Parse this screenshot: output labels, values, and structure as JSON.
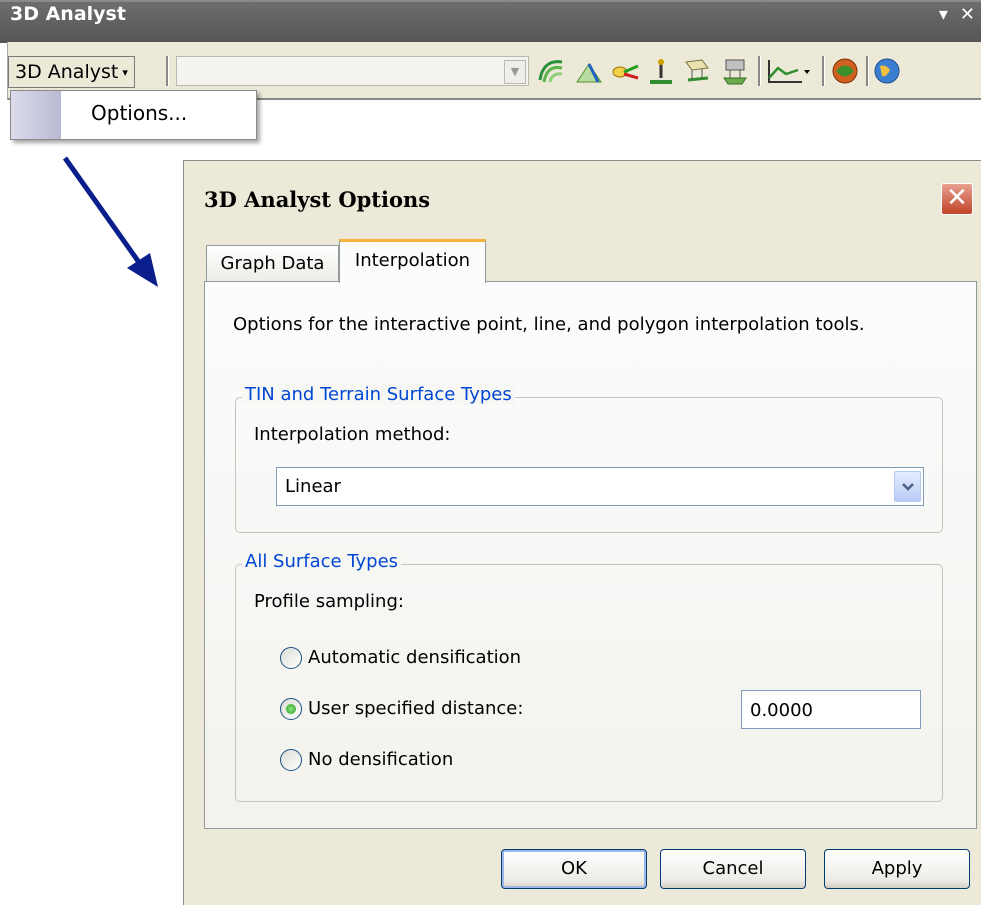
{
  "toolbar": {
    "title": "3D Analyst",
    "minimize_glyph": "▾",
    "close_glyph": "✕",
    "menu_label": "3D Analyst",
    "menu_caret": "▾",
    "combo_arrow": "▼",
    "icons": [
      "contour-icon",
      "steepest-path-icon",
      "line-of-sight-icon",
      "point-interpolate-icon",
      "interpolate-line-icon",
      "interpolate-polygon-icon",
      "profile-graph-icon",
      "arcscene-icon",
      "arcglobe-icon"
    ]
  },
  "dropdown_menu": {
    "items": [
      {
        "label": "Options..."
      }
    ]
  },
  "dialog": {
    "title": "3D Analyst Options",
    "close_glyph": "✕",
    "tabs": [
      {
        "label": "Graph Data"
      },
      {
        "label": "Interpolation"
      }
    ],
    "active_tab": "Interpolation",
    "description": "Options for the interactive point, line, and polygon interpolation tools.",
    "tin_group": {
      "title": "TIN and Terrain Surface Types",
      "method_label": "Interpolation method:",
      "method_value": "Linear",
      "arrow_glyph": "⌄"
    },
    "surface_group": {
      "title": "All Surface Types",
      "sampling_label": "Profile sampling:",
      "options": [
        {
          "label": "Automatic densification",
          "selected": false
        },
        {
          "label": "User specified distance:",
          "selected": true
        },
        {
          "label": "No densification",
          "selected": false
        }
      ],
      "distance_value": "0.0000"
    },
    "buttons": {
      "ok": "OK",
      "cancel": "Cancel",
      "apply": "Apply"
    }
  },
  "colors": {
    "title_bar": "#5f5f5f",
    "dialog_bg": "#ece9d8",
    "group_title": "#0046d5",
    "tab_highlight": "#f4b43c",
    "close_red": "#c24328",
    "arrow": "#0a1e8c"
  }
}
